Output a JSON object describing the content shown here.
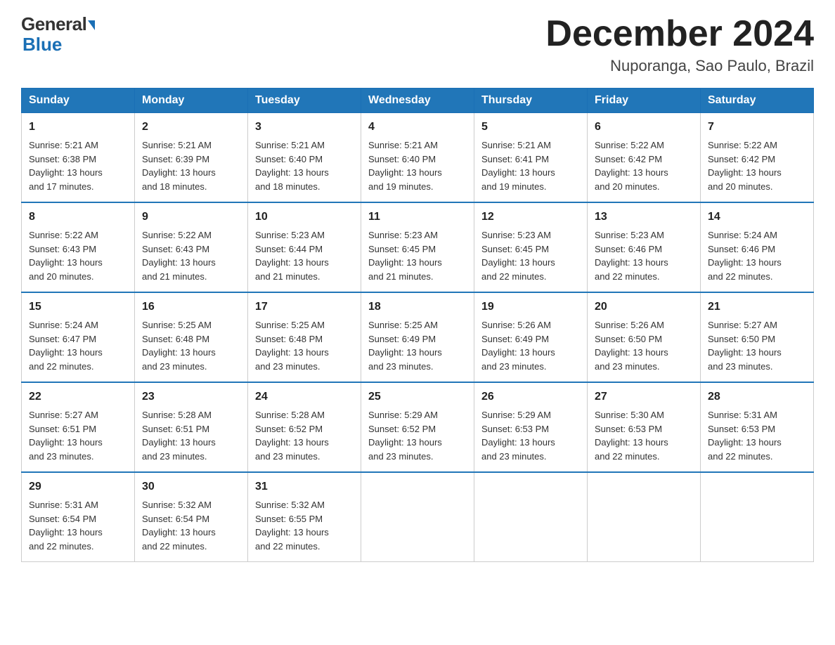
{
  "header": {
    "logo_top": "General",
    "logo_bottom": "Blue",
    "title": "December 2024",
    "subtitle": "Nuporanga, Sao Paulo, Brazil"
  },
  "days_of_week": [
    "Sunday",
    "Monday",
    "Tuesday",
    "Wednesday",
    "Thursday",
    "Friday",
    "Saturday"
  ],
  "weeks": [
    [
      {
        "day": "1",
        "sunrise": "5:21 AM",
        "sunset": "6:38 PM",
        "daylight": "13 hours and 17 minutes."
      },
      {
        "day": "2",
        "sunrise": "5:21 AM",
        "sunset": "6:39 PM",
        "daylight": "13 hours and 18 minutes."
      },
      {
        "day": "3",
        "sunrise": "5:21 AM",
        "sunset": "6:40 PM",
        "daylight": "13 hours and 18 minutes."
      },
      {
        "day": "4",
        "sunrise": "5:21 AM",
        "sunset": "6:40 PM",
        "daylight": "13 hours and 19 minutes."
      },
      {
        "day": "5",
        "sunrise": "5:21 AM",
        "sunset": "6:41 PM",
        "daylight": "13 hours and 19 minutes."
      },
      {
        "day": "6",
        "sunrise": "5:22 AM",
        "sunset": "6:42 PM",
        "daylight": "13 hours and 20 minutes."
      },
      {
        "day": "7",
        "sunrise": "5:22 AM",
        "sunset": "6:42 PM",
        "daylight": "13 hours and 20 minutes."
      }
    ],
    [
      {
        "day": "8",
        "sunrise": "5:22 AM",
        "sunset": "6:43 PM",
        "daylight": "13 hours and 20 minutes."
      },
      {
        "day": "9",
        "sunrise": "5:22 AM",
        "sunset": "6:43 PM",
        "daylight": "13 hours and 21 minutes."
      },
      {
        "day": "10",
        "sunrise": "5:23 AM",
        "sunset": "6:44 PM",
        "daylight": "13 hours and 21 minutes."
      },
      {
        "day": "11",
        "sunrise": "5:23 AM",
        "sunset": "6:45 PM",
        "daylight": "13 hours and 21 minutes."
      },
      {
        "day": "12",
        "sunrise": "5:23 AM",
        "sunset": "6:45 PM",
        "daylight": "13 hours and 22 minutes."
      },
      {
        "day": "13",
        "sunrise": "5:23 AM",
        "sunset": "6:46 PM",
        "daylight": "13 hours and 22 minutes."
      },
      {
        "day": "14",
        "sunrise": "5:24 AM",
        "sunset": "6:46 PM",
        "daylight": "13 hours and 22 minutes."
      }
    ],
    [
      {
        "day": "15",
        "sunrise": "5:24 AM",
        "sunset": "6:47 PM",
        "daylight": "13 hours and 22 minutes."
      },
      {
        "day": "16",
        "sunrise": "5:25 AM",
        "sunset": "6:48 PM",
        "daylight": "13 hours and 23 minutes."
      },
      {
        "day": "17",
        "sunrise": "5:25 AM",
        "sunset": "6:48 PM",
        "daylight": "13 hours and 23 minutes."
      },
      {
        "day": "18",
        "sunrise": "5:25 AM",
        "sunset": "6:49 PM",
        "daylight": "13 hours and 23 minutes."
      },
      {
        "day": "19",
        "sunrise": "5:26 AM",
        "sunset": "6:49 PM",
        "daylight": "13 hours and 23 minutes."
      },
      {
        "day": "20",
        "sunrise": "5:26 AM",
        "sunset": "6:50 PM",
        "daylight": "13 hours and 23 minutes."
      },
      {
        "day": "21",
        "sunrise": "5:27 AM",
        "sunset": "6:50 PM",
        "daylight": "13 hours and 23 minutes."
      }
    ],
    [
      {
        "day": "22",
        "sunrise": "5:27 AM",
        "sunset": "6:51 PM",
        "daylight": "13 hours and 23 minutes."
      },
      {
        "day": "23",
        "sunrise": "5:28 AM",
        "sunset": "6:51 PM",
        "daylight": "13 hours and 23 minutes."
      },
      {
        "day": "24",
        "sunrise": "5:28 AM",
        "sunset": "6:52 PM",
        "daylight": "13 hours and 23 minutes."
      },
      {
        "day": "25",
        "sunrise": "5:29 AM",
        "sunset": "6:52 PM",
        "daylight": "13 hours and 23 minutes."
      },
      {
        "day": "26",
        "sunrise": "5:29 AM",
        "sunset": "6:53 PM",
        "daylight": "13 hours and 23 minutes."
      },
      {
        "day": "27",
        "sunrise": "5:30 AM",
        "sunset": "6:53 PM",
        "daylight": "13 hours and 22 minutes."
      },
      {
        "day": "28",
        "sunrise": "5:31 AM",
        "sunset": "6:53 PM",
        "daylight": "13 hours and 22 minutes."
      }
    ],
    [
      {
        "day": "29",
        "sunrise": "5:31 AM",
        "sunset": "6:54 PM",
        "daylight": "13 hours and 22 minutes."
      },
      {
        "day": "30",
        "sunrise": "5:32 AM",
        "sunset": "6:54 PM",
        "daylight": "13 hours and 22 minutes."
      },
      {
        "day": "31",
        "sunrise": "5:32 AM",
        "sunset": "6:55 PM",
        "daylight": "13 hours and 22 minutes."
      },
      null,
      null,
      null,
      null
    ]
  ],
  "labels": {
    "sunrise": "Sunrise:",
    "sunset": "Sunset:",
    "daylight": "Daylight:"
  }
}
